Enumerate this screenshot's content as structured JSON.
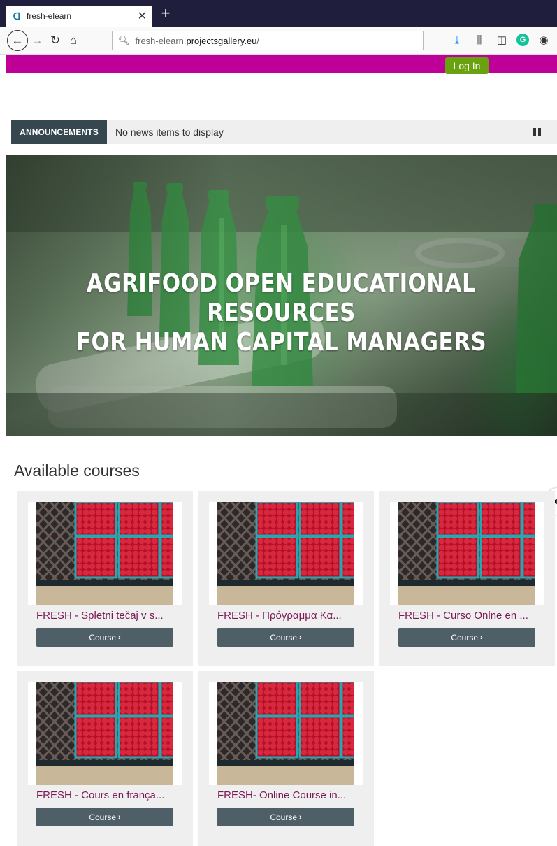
{
  "browser": {
    "tab_title": "fresh-elearn",
    "url_prefix": "fresh-elearn.",
    "url_domain": "projectsgallery.eu",
    "url_suffix": "/"
  },
  "header": {
    "login_label": "Log In",
    "brand_color": "#be0099",
    "login_color": "#6aa10e"
  },
  "announcements": {
    "label": "ANNOUNCEMENTS",
    "text": "No news items to display"
  },
  "banner": {
    "line1": "AGRIFOOD OPEN EDUCATIONAL RESOURCES",
    "line2": "FOR HUMAN CAPITAL MANAGERS"
  },
  "courses": {
    "section_title": "Available courses",
    "button_label": "Course",
    "items": [
      {
        "name": "FRESH - Spletni tečaj v s..."
      },
      {
        "name": "FRESH - Πρόγραμμα Κα..."
      },
      {
        "name": "FRESH - Curso Onlne en ..."
      },
      {
        "name": "FRESH - Cours en frança..."
      },
      {
        "name": "FRESH- Online Course in..."
      }
    ]
  }
}
